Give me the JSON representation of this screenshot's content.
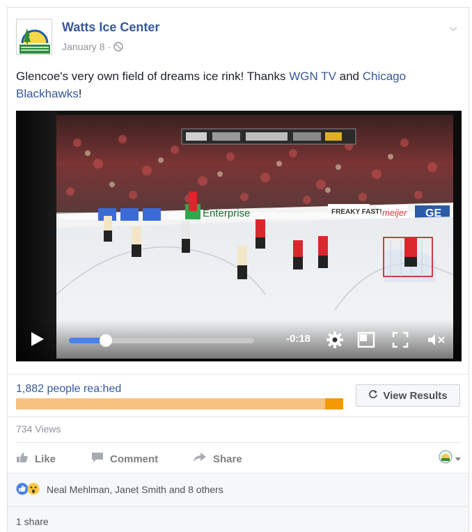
{
  "post": {
    "page_name": "Watts Ice Center",
    "date": "January 8 ·",
    "text_before": "Glencoe's very own field of dreams ice rink! Thanks ",
    "link_1": "WGN TV",
    "text_mid": " and ",
    "link_2": "Chicago Blackhawks",
    "text_after": "!"
  },
  "video": {
    "time_remaining": "-0:18",
    "progress_fraction": 0.2,
    "rink_ads": [
      "Enterprise",
      "FREAKY FAST!",
      "meijer",
      "GE"
    ],
    "controls": [
      "play-icon",
      "settings-gear-icon",
      "pip-icon",
      "fullscreen-icon",
      "mute-icon"
    ]
  },
  "reach": {
    "text": "1,882 people rea:hed",
    "button_label": "View Results"
  },
  "stats": {
    "views": "734 Views"
  },
  "actions": {
    "like": "Like",
    "comment": "Comment",
    "share": "Share"
  },
  "reactions": {
    "names": "Neal Mehlman, Janet Smith and 8 others"
  },
  "shares": {
    "count": "1 share"
  },
  "colors": {
    "link": "#365899",
    "progress": "#4a80ea",
    "reach_bar": "#f6c27f",
    "reach_bar_end": "#f29800"
  }
}
